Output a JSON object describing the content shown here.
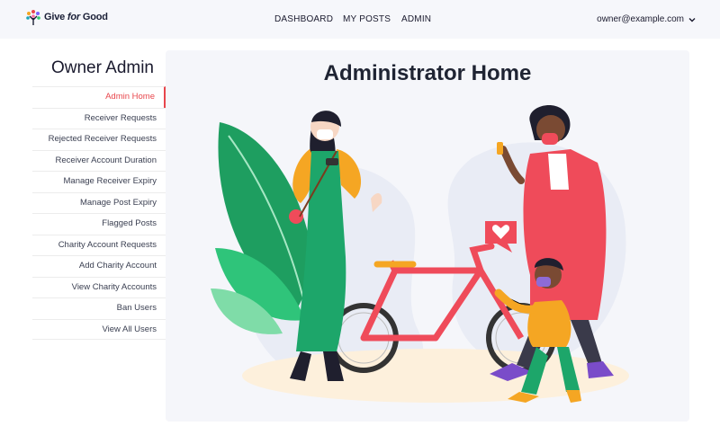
{
  "header": {
    "brand": {
      "name_prefix": "Give ",
      "name_italic": "for",
      "name_suffix": " Good"
    },
    "nav": [
      {
        "label": "DASHBOARD"
      },
      {
        "label": "MY POSTS"
      },
      {
        "label": "ADMIN"
      }
    ],
    "account": {
      "email": "owner@example.com",
      "icon": "chevron-down-icon"
    }
  },
  "sidebar": {
    "title": "Owner Admin",
    "active_index": 0,
    "items": [
      {
        "label": "Admin Home"
      },
      {
        "label": "Receiver Requests"
      },
      {
        "label": "Rejected Receiver Requests"
      },
      {
        "label": "Receiver Account Duration"
      },
      {
        "label": "Manage Receiver Expiry"
      },
      {
        "label": "Manage Post Expiry"
      },
      {
        "label": "Flagged Posts"
      },
      {
        "label": "Charity Account Requests"
      },
      {
        "label": "Add Charity Account"
      },
      {
        "label": "View Charity Accounts"
      },
      {
        "label": "Ban Users"
      },
      {
        "label": "View All Users"
      }
    ]
  },
  "main": {
    "title": "Administrator Home",
    "illustration": "people-with-bicycle-illustration"
  },
  "colors": {
    "accent": "#e8464c",
    "header_bg": "#f6f7fb",
    "panel_bg": "#f5f6fa"
  }
}
